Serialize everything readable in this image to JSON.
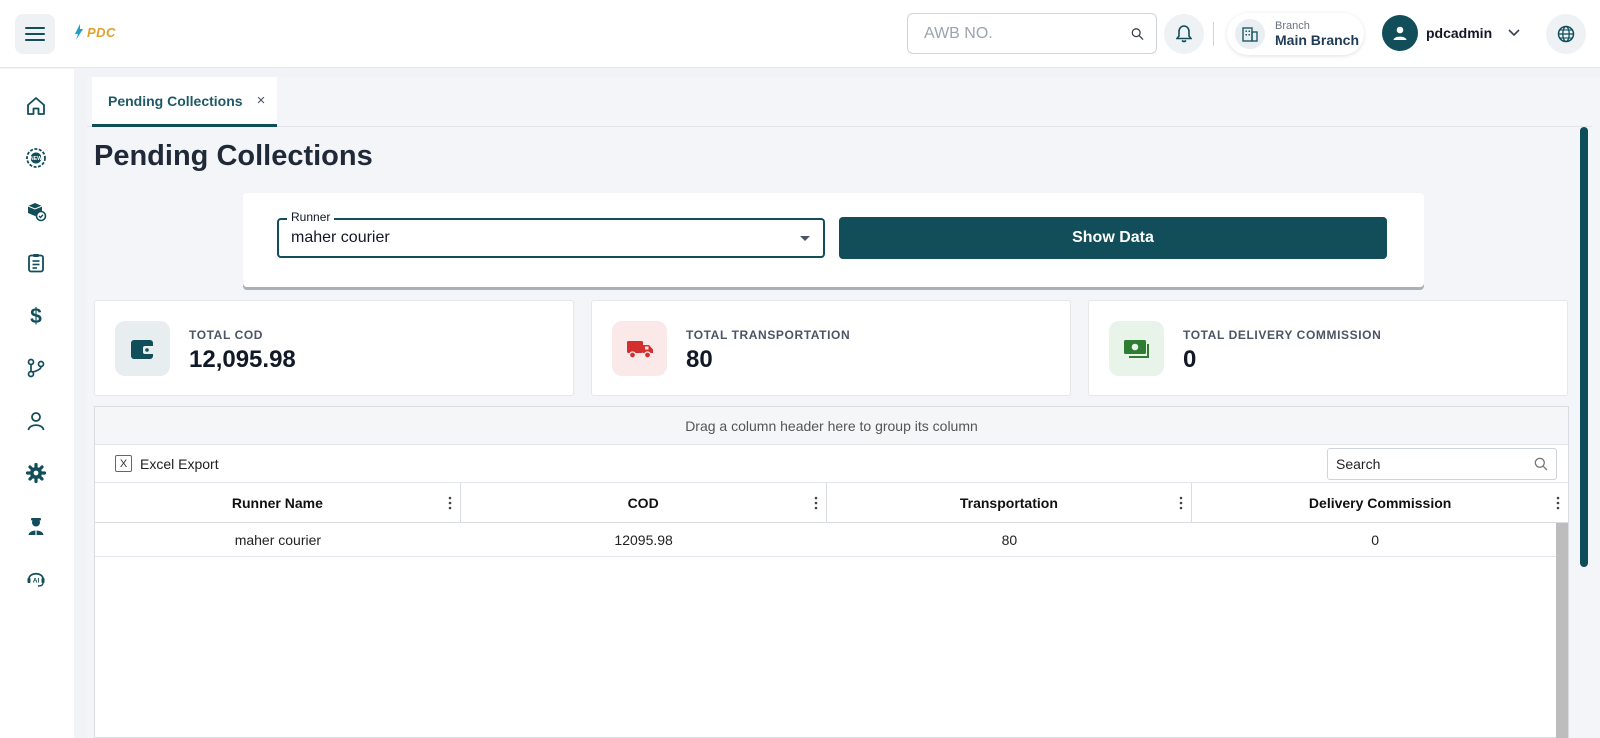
{
  "header": {
    "logo_text": "PDC",
    "awb_placeholder": "AWB NO.",
    "branch_caption": "Branch",
    "branch_name": "Main Branch",
    "username": "pdcadmin"
  },
  "sidebar": {
    "items": [
      "home-icon",
      "new-badge-icon",
      "packages-icon",
      "clipboard-icon",
      "dollar-icon",
      "branch-icon",
      "user-icon",
      "settings-icon",
      "agent-icon",
      "ai-support-icon"
    ],
    "accent": "#114e5a"
  },
  "tab": {
    "label": "Pending Collections",
    "close": "×"
  },
  "page": {
    "title": "Pending Collections"
  },
  "filter": {
    "runner_label": "Runner",
    "runner_value": "maher courier",
    "show_button": "Show Data"
  },
  "stats": [
    {
      "label": "TOTAL COD",
      "value": "12,095.98",
      "icon": "wallet-icon",
      "color": "#114e5a"
    },
    {
      "label": "TOTAL TRANSPORTATION",
      "value": "80",
      "icon": "truck-icon",
      "color": "#d32f2f"
    },
    {
      "label": "TOTAL DELIVERY COMMISSION",
      "value": "0",
      "icon": "cash-icon",
      "color": "#2e7d32"
    }
  ],
  "grid": {
    "group_hint": "Drag a column header here to group its column",
    "excel_label": "Excel Export",
    "search_placeholder": "Search",
    "columns": [
      "Runner Name",
      "COD",
      "Transportation",
      "Delivery Commission"
    ],
    "rows": [
      [
        "maher courier",
        "12095.98",
        "80",
        "0"
      ]
    ]
  }
}
